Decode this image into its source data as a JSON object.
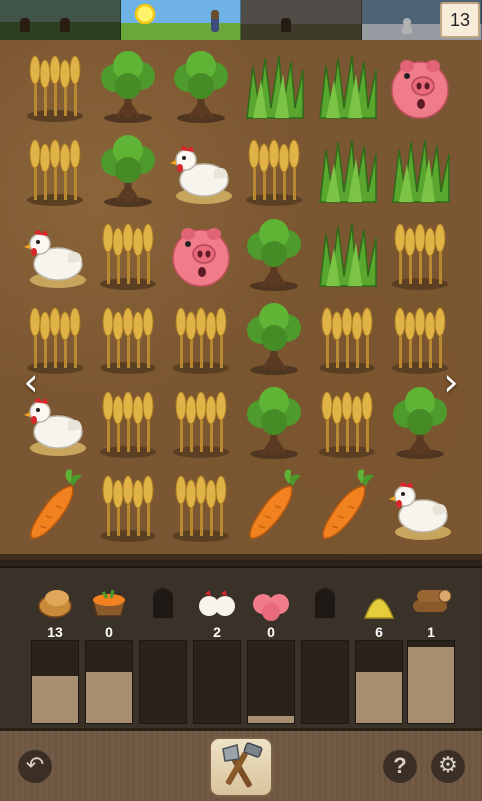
{
  "game": {
    "turn_counter": "13",
    "seasons": [
      "autumn",
      "summer",
      "late-autumn",
      "winter"
    ],
    "active_season_index": 1
  },
  "board": {
    "columns": 6,
    "rows": 6,
    "grid": [
      [
        "wheat",
        "tree",
        "tree",
        "grass",
        "grass",
        "pig"
      ],
      [
        "wheat",
        "tree",
        "chicken",
        "wheat",
        "grass",
        "grass"
      ],
      [
        "chicken",
        "wheat",
        "pig",
        "tree",
        "grass",
        "wheat"
      ],
      [
        "wheat",
        "wheat",
        "wheat",
        "tree",
        "wheat",
        "wheat"
      ],
      [
        "chicken",
        "wheat",
        "wheat",
        "tree",
        "wheat",
        "tree"
      ],
      [
        "carrot",
        "wheat",
        "wheat",
        "carrot",
        "carrot",
        "chicken"
      ]
    ],
    "nav": {
      "left_icon": "chevron-left-icon",
      "right_icon": "chevron-right-icon",
      "left_glyph": "‹",
      "right_glyph": "›"
    }
  },
  "inventory": [
    {
      "icon": "bread-icon",
      "count": "13",
      "fill": 0.57,
      "visible": true
    },
    {
      "icon": "carrot-basket-icon",
      "count": "0",
      "fill": 0.62,
      "visible": true
    },
    {
      "icon": "locked-silhouette-icon",
      "count": "",
      "fill": 0.0,
      "visible": false
    },
    {
      "icon": "chickens-icon",
      "count": "2",
      "fill": 0.0,
      "visible": true
    },
    {
      "icon": "pigs-icon",
      "count": "0",
      "fill": 0.08,
      "visible": true
    },
    {
      "icon": "locked-silhouette-icon",
      "count": "",
      "fill": 0.0,
      "visible": false
    },
    {
      "icon": "hay-icon",
      "count": "6",
      "fill": 0.62,
      "visible": true
    },
    {
      "icon": "logs-icon",
      "count": "1",
      "fill": 0.93,
      "visible": true
    }
  ],
  "toolbar": {
    "undo_glyph": "↶",
    "help_glyph": "?",
    "settings_glyph": "⚙",
    "build_icon": "axe-hammer-icon"
  },
  "colors": {
    "soil": "#7a5632",
    "wheat": "#e0b347",
    "tree_leaf": "#4e9a2c",
    "grass": "#5aa72f",
    "pig": "#f07c8a",
    "carrot": "#f2821f",
    "bar_fill": "#a98f72"
  }
}
